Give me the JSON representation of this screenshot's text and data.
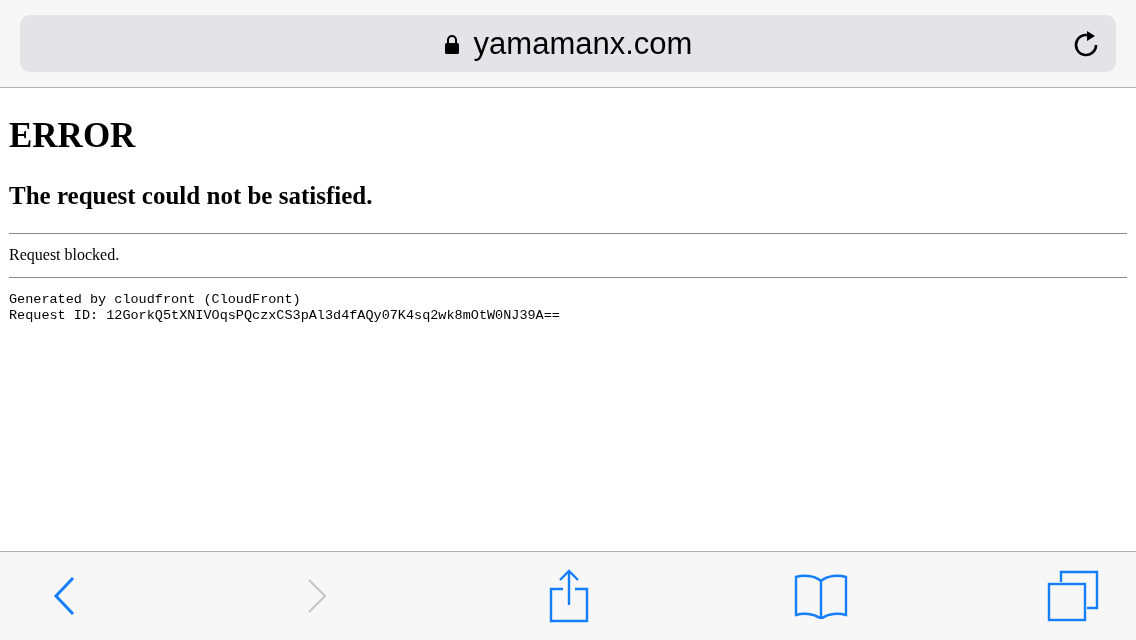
{
  "address_bar": {
    "domain": "yamamanx.com",
    "secure": true
  },
  "page": {
    "heading": "ERROR",
    "subheading": "The request could not be satisfied.",
    "message": "Request blocked.",
    "details": [
      "Generated by cloudfront (CloudFront)",
      "Request ID: 12GorkQ5tXNIVOqsPQczxCS3pAl3d4fAQy07K4sq2wk8mOtW0NJ39A=="
    ]
  },
  "toolbar": [
    {
      "kind": "back",
      "disabled": false
    },
    {
      "kind": "forward",
      "disabled": true
    },
    {
      "kind": "share",
      "disabled": false
    },
    {
      "kind": "bookmarks",
      "disabled": false
    },
    {
      "kind": "tabs",
      "disabled": false
    }
  ]
}
